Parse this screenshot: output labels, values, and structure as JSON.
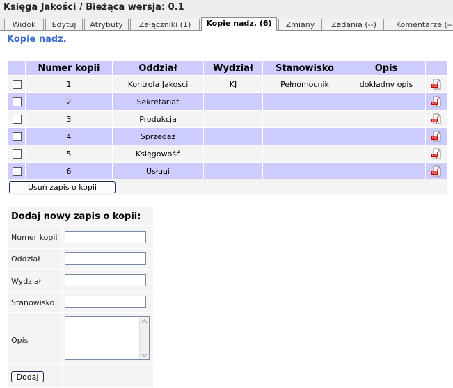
{
  "header": {
    "title": "Księga Jakości / Bieżąca wersja: 0.1"
  },
  "tabs": [
    {
      "label": "Widok"
    },
    {
      "label": "Edytuj"
    },
    {
      "label": "Atrybuty"
    },
    {
      "label": "Załączniki (1)"
    },
    {
      "label": "Kopie nadz. (6)",
      "active": true
    },
    {
      "label": "Zmiany"
    },
    {
      "label": "Zadania (--)"
    },
    {
      "label": "Komentarze (--"
    }
  ],
  "section": {
    "title": "Kopie nadz."
  },
  "table": {
    "columns": [
      "",
      "Numer kopii",
      "Oddział",
      "Wydział",
      "Stanowisko",
      "Opis",
      ""
    ],
    "rows": [
      {
        "numer": "1",
        "oddzial": "Kontrola Jakości",
        "wydzial": "KJ",
        "stanowisko": "Pełnomocnik",
        "opis": "dokładny opis"
      },
      {
        "numer": "2",
        "oddzial": "Sekretariat",
        "wydzial": "",
        "stanowisko": "",
        "opis": ""
      },
      {
        "numer": "3",
        "oddzial": "Produkcja",
        "wydzial": "",
        "stanowisko": "",
        "opis": ""
      },
      {
        "numer": "4",
        "oddzial": "Sprzedaż",
        "wydzial": "",
        "stanowisko": "",
        "opis": ""
      },
      {
        "numer": "5",
        "oddzial": "Księgowość",
        "wydzial": "",
        "stanowisko": "",
        "opis": ""
      },
      {
        "numer": "6",
        "oddzial": "Usługi",
        "wydzial": "",
        "stanowisko": "",
        "opis": ""
      }
    ],
    "row_icon": "pdf-icon",
    "delete_button": "Usuń zapis o kopii"
  },
  "form": {
    "title": "Dodaj nowy zapis o kopii:",
    "fields": [
      {
        "label": "Numer kopii",
        "value": ""
      },
      {
        "label": "Oddział",
        "value": ""
      },
      {
        "label": "Wydział",
        "value": ""
      },
      {
        "label": "Stanowisko",
        "value": ""
      }
    ],
    "opis_label": "Opis",
    "opis_value": "",
    "submit": "Dodaj"
  },
  "colors": {
    "accent": "#3a6ccb",
    "header_bg": "#ccccff",
    "row_alt": "#ccccff",
    "row_plain": "#f4f4f4"
  }
}
